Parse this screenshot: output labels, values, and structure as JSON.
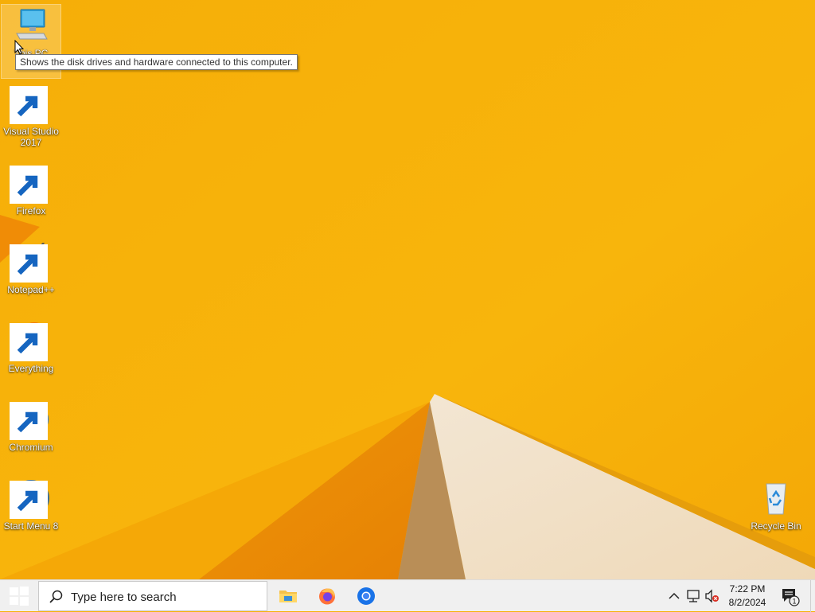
{
  "desktop": {
    "icons": [
      {
        "label": "This PC",
        "icon": "computer-icon",
        "shortcut": false
      },
      {
        "label": "Visual Studio\n2017",
        "icon": "visual-studio-icon",
        "shortcut": true
      },
      {
        "label": "Firefox",
        "icon": "firefox-icon",
        "shortcut": true
      },
      {
        "label": "Notepad++",
        "icon": "notepadpp-icon",
        "shortcut": true
      },
      {
        "label": "Everything",
        "icon": "everything-icon",
        "shortcut": true
      },
      {
        "label": "Chromium",
        "icon": "chromium-icon",
        "shortcut": true
      },
      {
        "label": "Start Menu 8",
        "icon": "start-menu-8-icon",
        "shortcut": true
      }
    ],
    "recycle_bin": {
      "label": "Recycle Bin",
      "icon": "recycle-bin-icon"
    },
    "tooltip": "Shows the disk drives and hardware connected to this computer.",
    "colors": {
      "wallpaper_base": "#f7b20a",
      "wallpaper_dark": "#e88a05",
      "wallpaper_light": "#f2dfc4"
    }
  },
  "taskbar": {
    "search_placeholder": "Type here to search",
    "pinned": [
      "file-explorer-icon",
      "firefox-icon",
      "chromium-icon"
    ],
    "tray": [
      "chevron-up-icon",
      "network-icon",
      "volume-muted-icon"
    ],
    "clock": {
      "time": "7:22 PM",
      "date": "8/2/2024"
    },
    "notifications": {
      "icon": "action-center-icon",
      "count": "1"
    }
  }
}
